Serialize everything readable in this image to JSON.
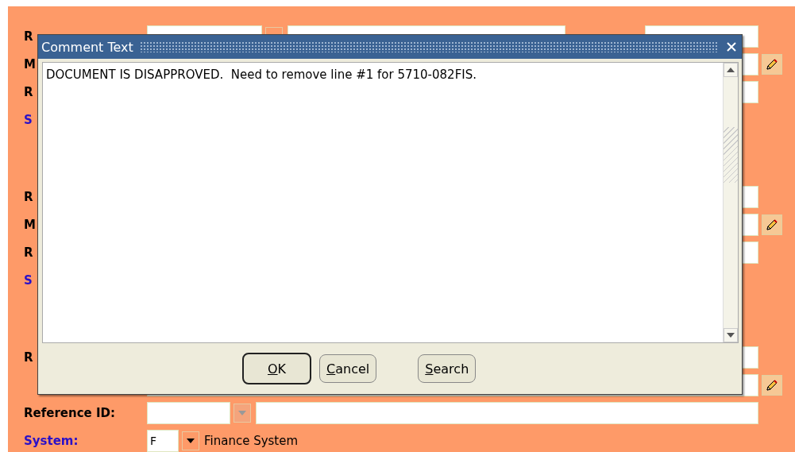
{
  "form": {
    "sections": [
      {
        "rows": [
          {
            "kind": "lookup",
            "label": "R"
          },
          {
            "kind": "message",
            "label": "M"
          },
          {
            "kind": "plain",
            "label": "R"
          },
          {
            "kind": "system",
            "label": "S"
          }
        ]
      },
      {
        "rows": [
          {
            "kind": "plain",
            "label": "R"
          },
          {
            "kind": "message",
            "label": "M"
          },
          {
            "kind": "plain",
            "label": "R"
          },
          {
            "kind": "system",
            "label": "S"
          }
        ]
      },
      {
        "rows": [
          {
            "kind": "plain",
            "label": "R"
          },
          {
            "kind": "message"
          },
          {
            "kind": "reference",
            "label": "Reference ID:"
          },
          {
            "kind": "system",
            "label": "System:",
            "code": "F",
            "description": "Finance System"
          }
        ]
      }
    ]
  },
  "dialog": {
    "title": "Comment Text",
    "text": "DOCUMENT IS DISAPPROVED.  Need to remove line #1 for 5710-082FIS.",
    "buttons": [
      {
        "label": "OK",
        "selected": true
      },
      {
        "label": "Cancel",
        "selected": false
      },
      {
        "label": "Search",
        "selected": false
      }
    ]
  }
}
